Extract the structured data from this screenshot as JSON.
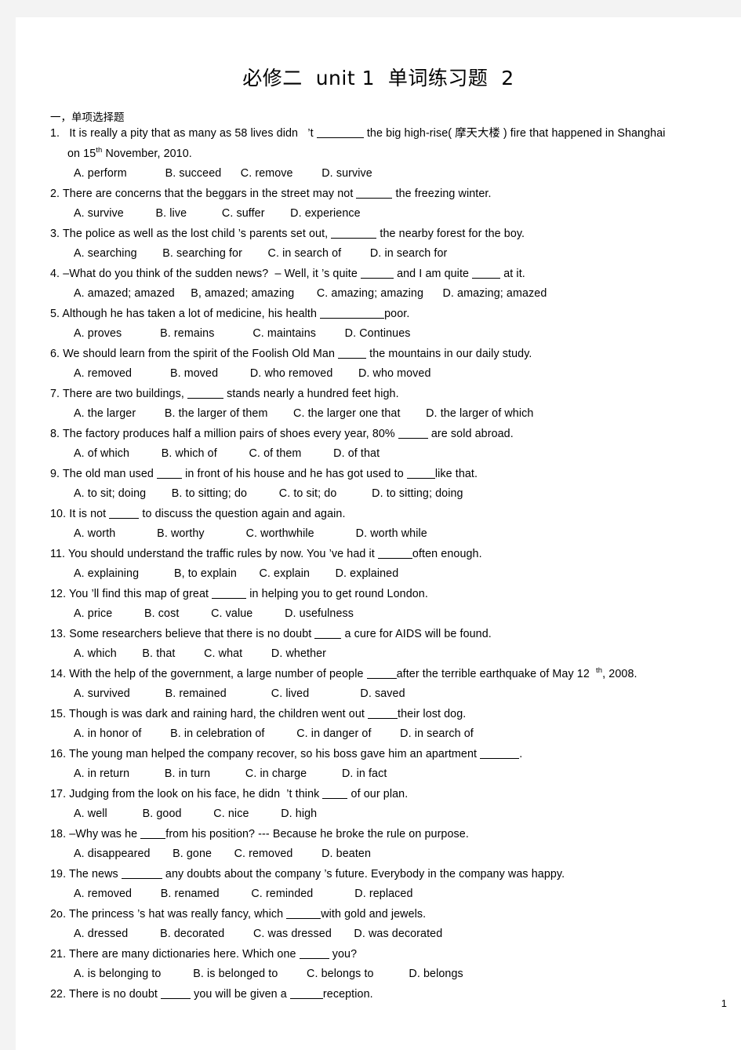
{
  "document": {
    "title": "必修二  unit 1  单词练习题  2",
    "section_heading": "一，单项选择题",
    "page_number": "1"
  },
  "questions": [
    {
      "number": "1.",
      "stem_line1": "It is really a pity that as many as 58 lives didn    ’t ________ the big high-rise( 摩天大楼 ) fire that happened in Shanghai",
      "stem_line2": "on 15th November, 2010.",
      "options": "A. perform            B. succeed      C. remove         D. survive"
    },
    {
      "number": "2.",
      "stem_line1": "There are concerns that the beggars in the street may not ______ the freezing winter.",
      "options": "A. survive          B. live           C. suffer        D. experience"
    },
    {
      "number": "3.",
      "stem_line1": "The police as well as the lost child ’s parents set out, ________ the nearby forest for the boy.",
      "options": "A. searching        B. searching for        C. in search of         D. in search for"
    },
    {
      "number": "4.",
      "stem_line1": "–What do you think of the sudden news?  – Well, it ’s quite ______ and I am quite _____ at it.",
      "options": "A. amazed; amazed     B, amazed; amazing       C. amazing; amazing      D. amazing; amazed"
    },
    {
      "number": "5.",
      "stem_line1": "Although he has taken a lot of medicine, his health ____________poor.",
      "options": "A. proves            B. remains            C. maintains         D. Continues"
    },
    {
      "number": "6.",
      "stem_line1": "We should learn from the spirit of the Foolish Old Man ____ the mountains in our daily study.",
      "options": "A. removed            B. moved          D. who removed        D. who moved"
    },
    {
      "number": "7.",
      "stem_line1": "There are two buildings, ______ stands nearly a hundred feet high.",
      "options": "A. the larger         B. the larger of them        C. the larger one that        D. the larger of which"
    },
    {
      "number": "8.",
      "stem_line1": "The factory produces half a million pairs of shoes every year, 80% _____ are sold abroad.",
      "options": "A. of which          B. which of          C. of them          D. of that"
    },
    {
      "number": "9.",
      "stem_line1": "The old man used ____ in front of his house and he has got used to _____like that.",
      "options": "A. to sit; doing        B. to sitting; do          C. to sit; do           D. to sitting; doing"
    },
    {
      "number": "10.",
      "stem_line1": "It is not _____ to discuss the question again and again.",
      "options": "A. worth             B. worthy             C. worthwhile             D. worth while"
    },
    {
      "number": "11.",
      "stem_line1": "You should understand the traffic rules by now. You ’ve had it ______often enough.",
      "options": "A. explaining           B, to explain       C. explain        D. explained"
    },
    {
      "number": "12.",
      "stem_line1": "You ’ll find this map of great ______ in helping you to get round London.",
      "options": "A. price          B. cost          C. value          D. usefulness"
    },
    {
      "number": "13.",
      "stem_line1": "Some researchers believe that there is no doubt ____ a cure for AIDS will be found.",
      "options": "A. which        B. that         C. what         D. whether"
    },
    {
      "number": "14.",
      "stem_line1": "With the help of the government, a large number of people _____after the terrible earthquake of May 12   th, 2008.",
      "options": "A. survived           B. remained              C. lived                D. saved"
    },
    {
      "number": "15.",
      "stem_line1": "Though is was dark and raining hard, the children went out _____their lost dog.",
      "options": "A. in honor of         B. in celebration of          C. in danger of         D. in search of"
    },
    {
      "number": "16.",
      "stem_line1": "The young man helped the company recover, so his boss gave him an apartment _______.",
      "options": "A. in return           B. in turn           C. in charge           D. in fact"
    },
    {
      "number": "17.",
      "stem_line1": "Judging from the look on his face, he didn  ’t think ____ of our plan.",
      "options": "A. well           B. good          C. nice          D. high"
    },
    {
      "number": "18.",
      "stem_line1": "–Why was he ____from his position? --- Because he broke the rule on purpose.",
      "options": "A. disappeared       B. gone       C. removed         D. beaten"
    },
    {
      "number": "19.",
      "stem_line1": "The news _______ any doubts about the company ’s future. Everybody in the company was happy.",
      "options": "A. removed         B. renamed          C. reminded             D. replaced"
    },
    {
      "number": "2o.",
      "stem_line1": "The princess ’s hat was really fancy, which ______with gold and jewels.",
      "options": "A. dressed          B. decorated         C. was dressed       D. was decorated"
    },
    {
      "number": "21.",
      "stem_line1": "There are many dictionaries here. Which one _____ you?",
      "options": "A. is belonging to          B. is belonged to         C. belongs to           D. belongs"
    },
    {
      "number": "22.",
      "stem_line1": "There is no doubt _____ you will be given a ______reception.",
      "options": ""
    }
  ]
}
